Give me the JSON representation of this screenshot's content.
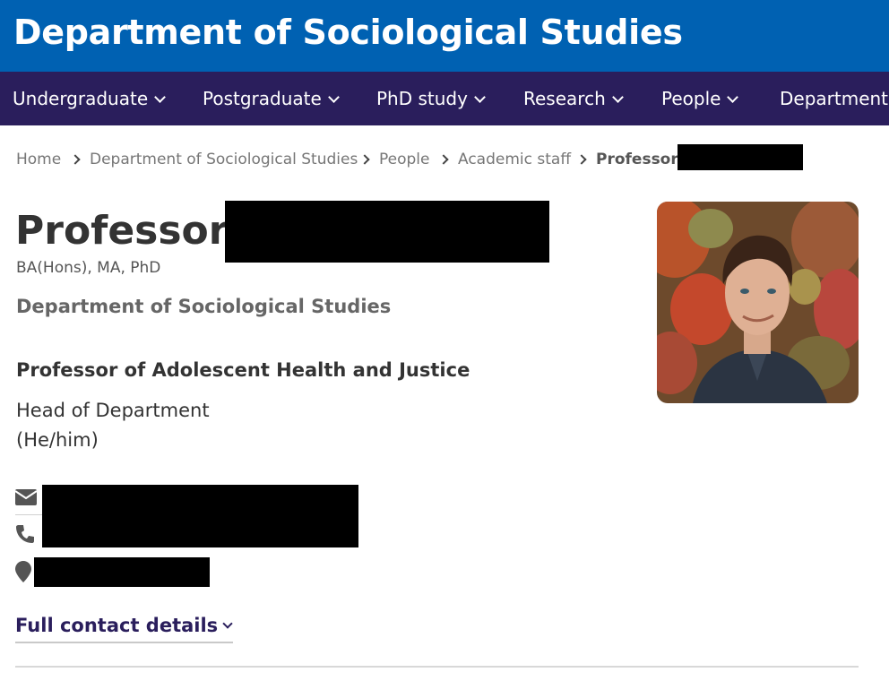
{
  "header": {
    "site_title": "Department of Sociological Studies"
  },
  "nav": {
    "items": [
      {
        "label": "Undergraduate"
      },
      {
        "label": "Postgraduate"
      },
      {
        "label": "PhD study"
      },
      {
        "label": "Research"
      },
      {
        "label": "People"
      },
      {
        "label": "Department"
      }
    ]
  },
  "breadcrumb": {
    "items": [
      "Home",
      "Department of Sociological Studies",
      "People",
      "Academic staff"
    ],
    "current": "Professor"
  },
  "profile": {
    "title_prefix": "Professor",
    "qualifications": "BA(Hons), MA, PhD",
    "department": "Department of Sociological Studies",
    "role_title": "Professor of Adolescent Health and Justice",
    "role_lines": [
      "Head of Department",
      "(He/him)"
    ]
  },
  "contact": {
    "icons": [
      "envelope-icon",
      "phone-icon",
      "location-pin-icon"
    ],
    "full_contact_label": "Full contact details"
  },
  "colors": {
    "header_bg": "#0061b2",
    "nav_bg": "#2a1e5c",
    "link_dark": "#2a1e5c"
  }
}
